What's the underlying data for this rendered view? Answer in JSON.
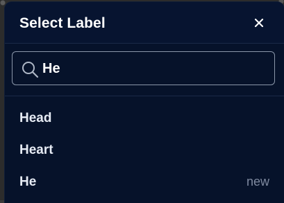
{
  "dialog": {
    "title": "Select Label",
    "close_icon": "close-icon"
  },
  "search": {
    "value": "He",
    "icon": "search-icon"
  },
  "options": [
    {
      "label": "Head",
      "badge": ""
    },
    {
      "label": "Heart",
      "badge": ""
    },
    {
      "label": "He",
      "badge": "new"
    }
  ],
  "colors": {
    "dialog_bg": "#06122a",
    "text": "#e6ebf4",
    "muted": "#7f8aa0",
    "border": "#8b97aa"
  }
}
